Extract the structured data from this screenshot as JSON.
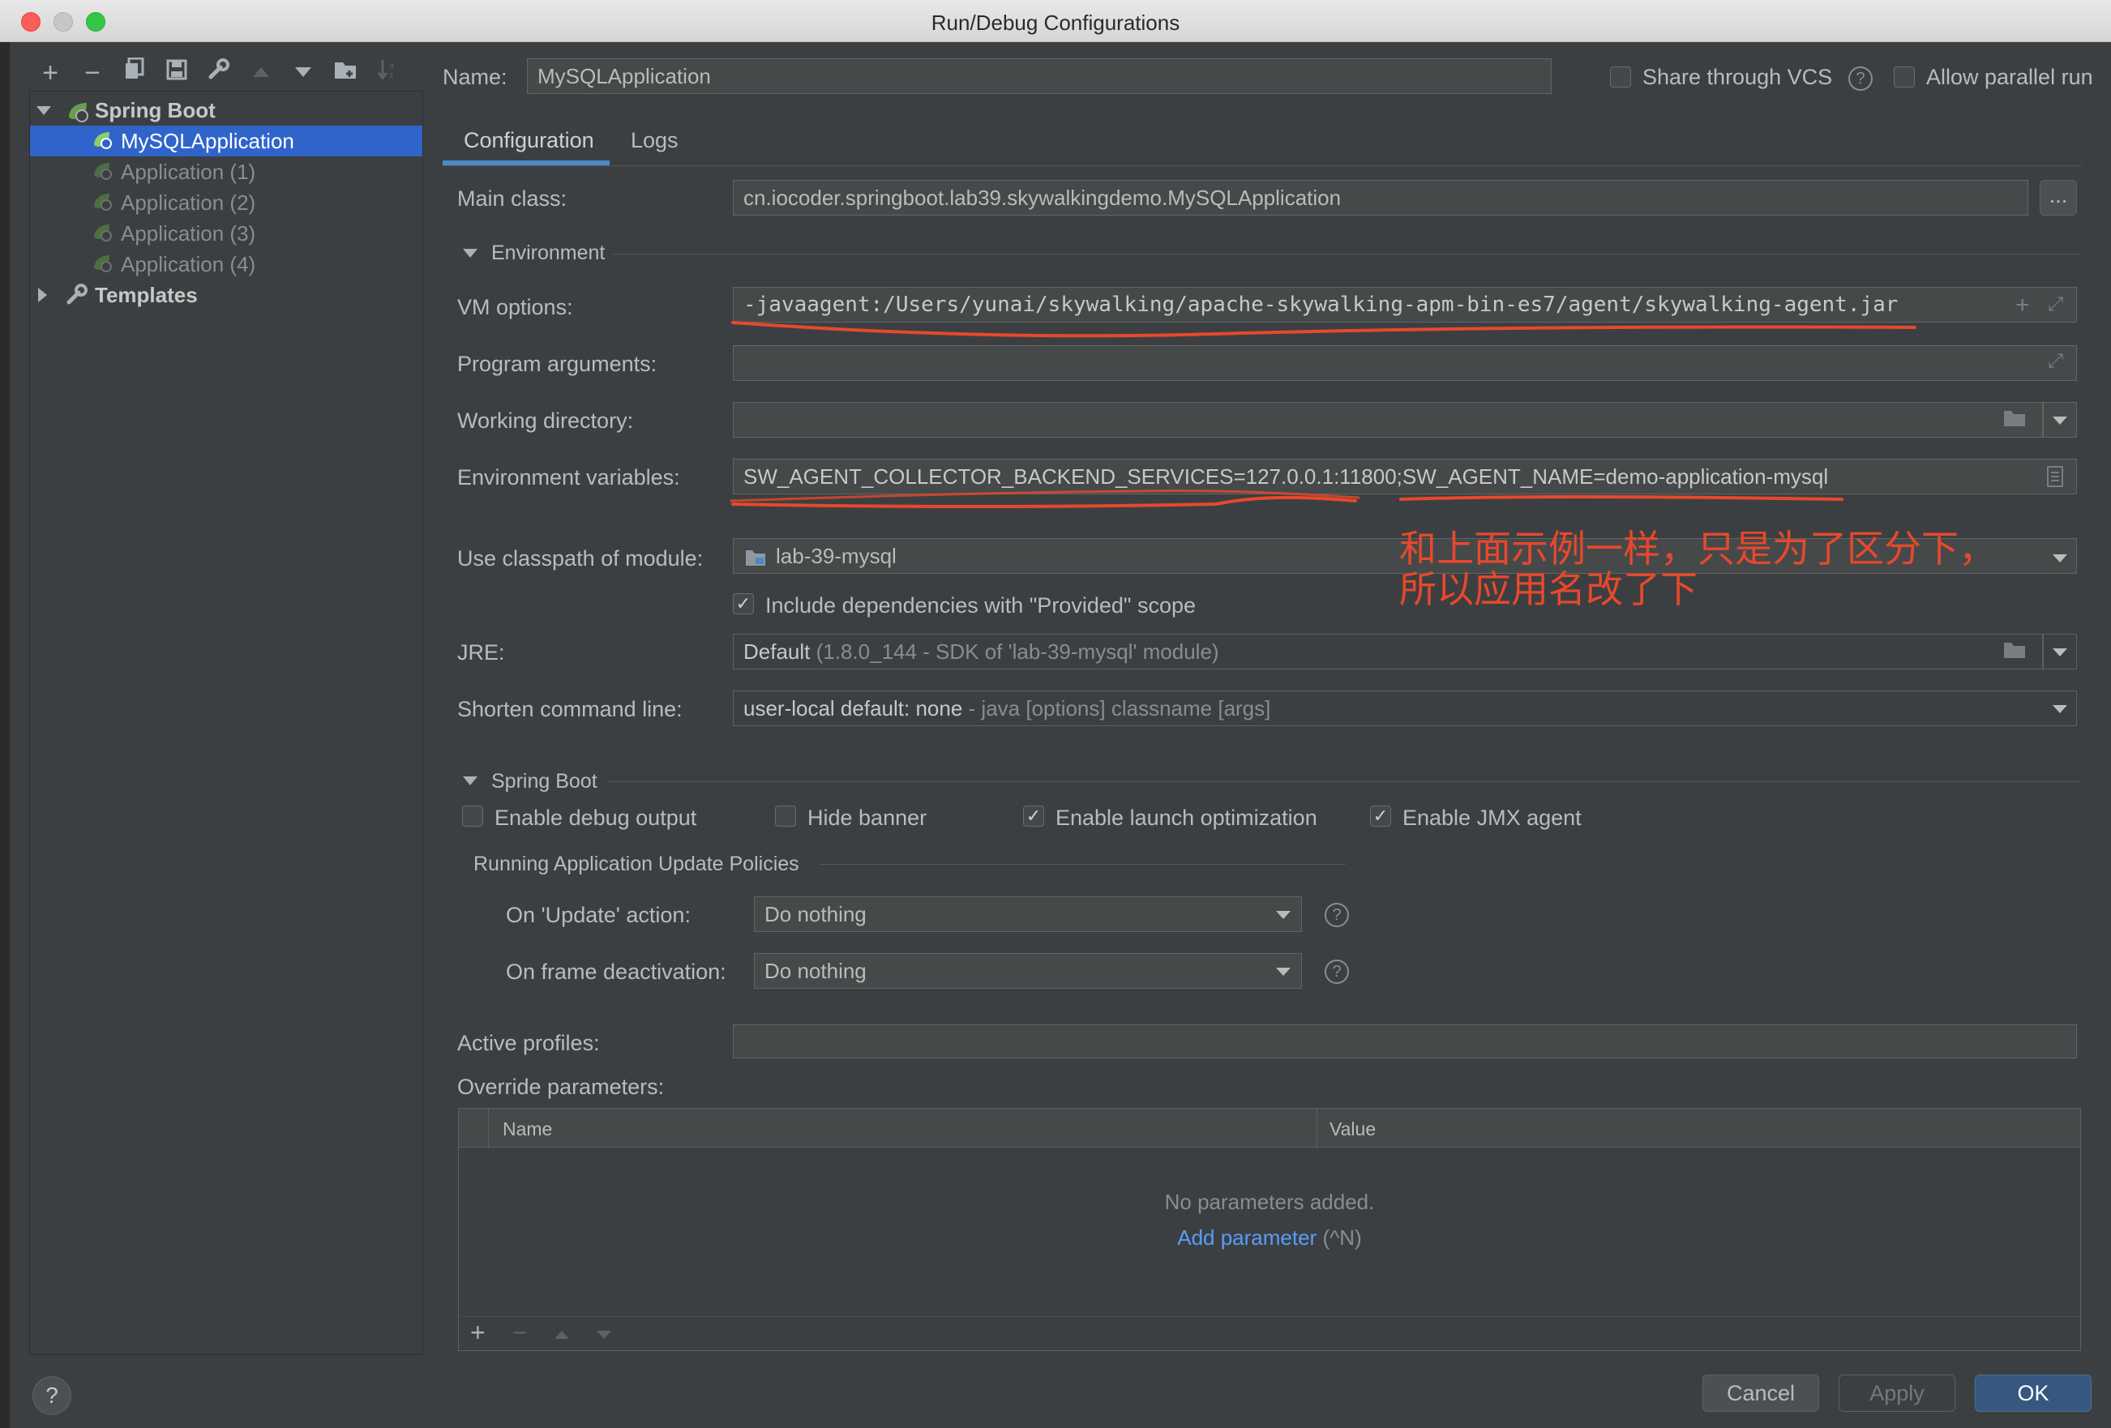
{
  "window": {
    "title": "Run/Debug Configurations"
  },
  "toolbar": {
    "add_icon": "plus-icon",
    "remove_icon": "minus-icon",
    "copy_icon": "copy-icon",
    "save_icon": "save-icon",
    "edit_icon": "wrench-icon",
    "up_icon": "arrow-up-icon",
    "down_icon": "arrow-down-icon",
    "folder_icon": "folder-icon",
    "sort_icon": "sort-icon"
  },
  "tree": {
    "group_label": "Spring Boot",
    "items": [
      {
        "label": "MySQLApplication"
      },
      {
        "label": "Application (1)"
      },
      {
        "label": "Application (2)"
      },
      {
        "label": "Application (3)"
      },
      {
        "label": "Application (4)"
      }
    ],
    "templates_label": "Templates"
  },
  "header": {
    "name_label": "Name:",
    "name_value": "MySQLApplication",
    "share_vcs": "Share through VCS",
    "allow_parallel": "Allow parallel run"
  },
  "tabs": [
    {
      "label": "Configuration"
    },
    {
      "label": "Logs"
    }
  ],
  "form": {
    "main_class_label": "Main class:",
    "main_class_value": "cn.iocoder.springboot.lab39.skywalkingdemo.MySQLApplication",
    "browse_label": "...",
    "environment_section": "Environment",
    "vm_options_label": "VM options:",
    "vm_options_value": "-javaagent:/Users/yunai/skywalking/apache-skywalking-apm-bin-es7/agent/skywalking-agent.jar",
    "program_args_label": "Program arguments:",
    "program_args_value": "",
    "working_dir_label": "Working directory:",
    "working_dir_value": "",
    "env_vars_label": "Environment variables:",
    "env_vars_value": "SW_AGENT_COLLECTOR_BACKEND_SERVICES=127.0.0.1:11800;SW_AGENT_NAME=demo-application-mysql",
    "classpath_label": "Use classpath of module:",
    "classpath_value": "lab-39-mysql",
    "include_deps_label": "Include dependencies with \"Provided\" scope",
    "jre_label": "JRE:",
    "jre_value_main": "Default",
    "jre_value_hint": "(1.8.0_144 - SDK of 'lab-39-mysql' module)",
    "shorten_label": "Shorten command line:",
    "shorten_value_main": "user-local default: none",
    "shorten_value_hint": "- java [options] classname [args]"
  },
  "spring_boot": {
    "section": "Spring Boot",
    "enable_debug": "Enable debug output",
    "hide_banner": "Hide banner",
    "enable_launch_opt": "Enable launch optimization",
    "enable_jmx": "Enable JMX agent",
    "policies_title": "Running Application Update Policies",
    "on_update_label": "On 'Update' action:",
    "on_update_value": "Do nothing",
    "on_frame_label": "On frame deactivation:",
    "on_frame_value": "Do nothing"
  },
  "profiles": {
    "active_label": "Active profiles:",
    "active_value": "",
    "override_label": "Override parameters:",
    "col_name": "Name",
    "col_value": "Value",
    "empty_text": "No parameters added.",
    "add_link": "Add parameter",
    "add_shortcut": "(^N)"
  },
  "annotation": {
    "line1": "和上面示例一样，只是为了区分下，",
    "line2": "所以应用名改了下"
  },
  "buttons": {
    "help": "?",
    "cancel": "Cancel",
    "apply": "Apply",
    "ok": "OK"
  },
  "colors": {
    "background": "#3c3f41",
    "selection": "#2f65ca",
    "field": "#45494a",
    "annotation": "#e8482c",
    "link": "#589df6",
    "primary_button": "#365880"
  }
}
